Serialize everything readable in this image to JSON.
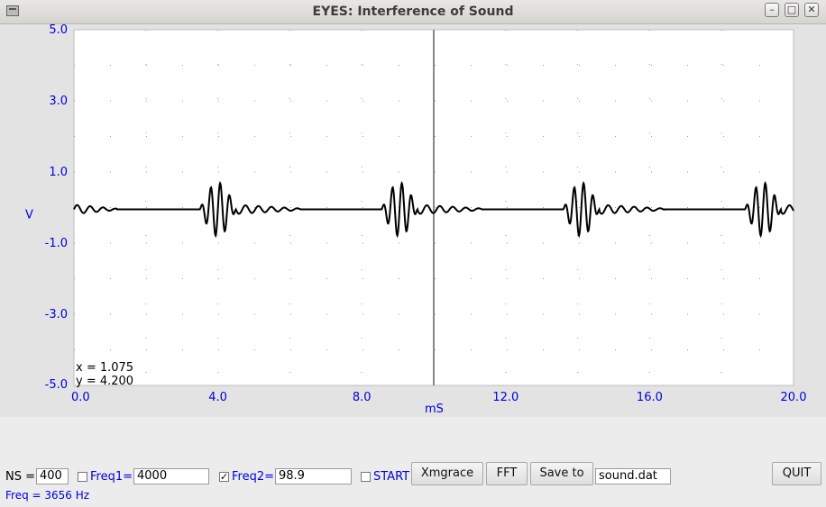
{
  "window": {
    "title": "EYES: Interference of Sound",
    "controls": [
      "minimize",
      "maximize",
      "close"
    ]
  },
  "chart_data": {
    "type": "line",
    "xlabel": "mS",
    "ylabel": "V",
    "xlim": [
      0,
      20
    ],
    "ylim": [
      -5,
      5
    ],
    "xticks": [
      "0.0",
      "4.0",
      "8.0",
      "12.0",
      "16.0",
      "20.0"
    ],
    "yticks": [
      "5.0",
      "3.0",
      "1.0",
      "-1.0",
      "-3.0",
      "-5.0"
    ],
    "grid": true,
    "cursor": {
      "x": 10.0
    },
    "readout": {
      "x": "x = 1.075",
      "y": "y = 4.200"
    },
    "series": [
      {
        "baseline": -0.05,
        "color": "#000000",
        "bursts": [
          {
            "center": 4.0,
            "amplitude": 0.75
          },
          {
            "center": 9.05,
            "amplitude": 0.75
          },
          {
            "center": 14.1,
            "amplitude": 0.75
          },
          {
            "center": 19.15,
            "amplitude": 0.75
          }
        ],
        "burst_period_ms": 0.26,
        "ripple": {
          "amplitude": 0.13,
          "period_ms": 0.36
        }
      }
    ]
  },
  "controls": {
    "ns_label": "NS =",
    "ns_value": "400",
    "freq1_label": "Freq1=",
    "freq1_value": "4000",
    "freq1_checked": false,
    "freq2_label": "Freq2=",
    "freq2_value": "98.9",
    "freq2_checked": true,
    "start_label": "START",
    "start_checked": false,
    "xmgrace_label": "Xmgrace",
    "fft_label": "FFT",
    "saveto_label": "Save to",
    "filename_value": "sound.dat",
    "quit_label": "QUIT",
    "status": "Freq =  3656 Hz"
  },
  "colors": {
    "accent": "#0000dd",
    "plot_bg": "#ffffff",
    "grid": "#9a9a9a"
  }
}
